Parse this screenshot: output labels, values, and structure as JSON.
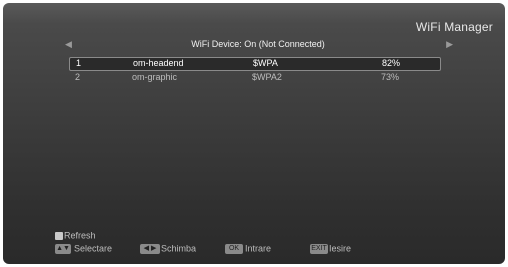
{
  "header": {
    "title": "WiFi Manager"
  },
  "device_bar": {
    "status": "WiFi Device: On (Not Connected)",
    "left_arrow": "◀",
    "right_arrow": "▶"
  },
  "networks": [
    {
      "index": "1",
      "name": "om-headend",
      "security": "$WPA",
      "signal": "82%",
      "selected": true
    },
    {
      "index": "2",
      "name": "om-graphic",
      "security": "$WPA2",
      "signal": "73%",
      "selected": false
    }
  ],
  "footer": {
    "refresh_label": "Refresh",
    "select_label": "Selectare",
    "select_key": "▲▼",
    "switch_label": "Schimba",
    "switch_key": "◀ ▶",
    "ok_label": "Intrare",
    "ok_key": "OK",
    "exit_label": "Iesire",
    "exit_key": "EXIT"
  },
  "colors": {
    "background_top": "#5a5a5a",
    "background_bottom": "#2a2a2a",
    "highlight_border": "#8a8a8a"
  }
}
